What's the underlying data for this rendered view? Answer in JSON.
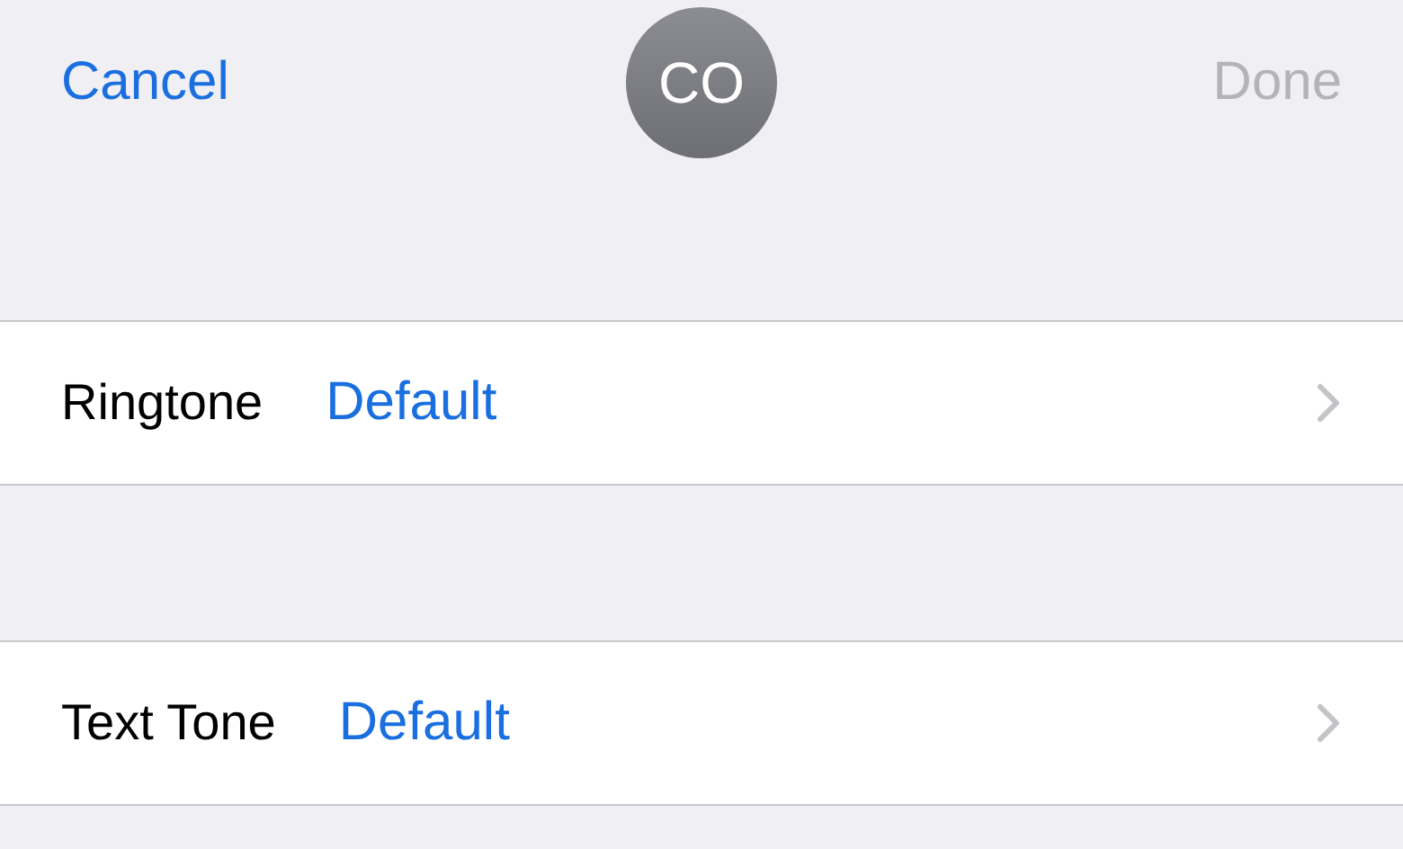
{
  "nav": {
    "cancel": "Cancel",
    "avatar": "CO",
    "done": {
      "label": "Done",
      "disabled": true
    }
  },
  "sections": [
    {
      "label": "Ringtone",
      "value": "Default"
    },
    {
      "label": "Text Tone",
      "value": "Default"
    }
  ]
}
